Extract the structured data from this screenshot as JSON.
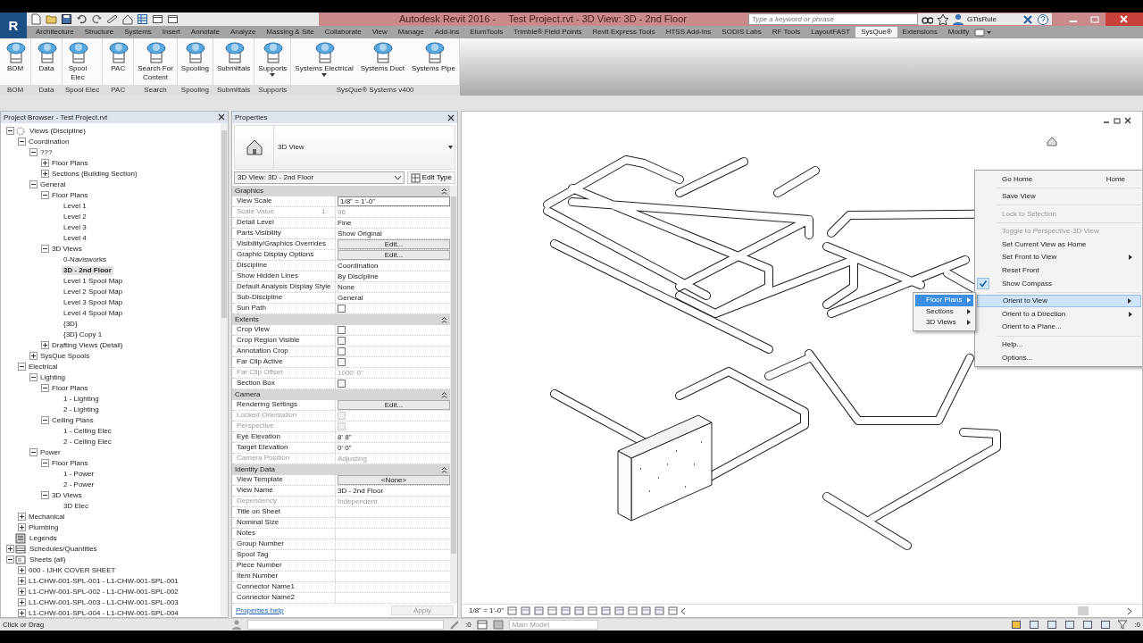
{
  "title_bar": {
    "app_button": "R",
    "app_name": "Autodesk Revit 2016 -",
    "document_title": "Test Project.rvt - 3D View: 3D - 2nd Floor",
    "search": {
      "placeholder": "Type a keyword or phrase"
    },
    "user": "GTisRule"
  },
  "ribbon_tabs": [
    {
      "label": "Architecture",
      "selected": false
    },
    {
      "label": "Structure",
      "selected": false
    },
    {
      "label": "Systems",
      "selected": false
    },
    {
      "label": "Insert",
      "selected": false
    },
    {
      "label": "Annotate",
      "selected": false
    },
    {
      "label": "Analyze",
      "selected": false
    },
    {
      "label": "Massing & Site",
      "selected": false
    },
    {
      "label": "Collaborate",
      "selected": false
    },
    {
      "label": "View",
      "selected": false
    },
    {
      "label": "Manage",
      "selected": false
    },
    {
      "label": "Add-Ins",
      "selected": false
    },
    {
      "label": "ElumTools",
      "selected": false
    },
    {
      "label": "Trimble® Field Points",
      "selected": false
    },
    {
      "label": "Revit Express Tools",
      "selected": false
    },
    {
      "label": "HTSS Add-Ins",
      "selected": false
    },
    {
      "label": "SODIS Labs",
      "selected": false
    },
    {
      "label": "RF Tools",
      "selected": false
    },
    {
      "label": "LayoutFAST",
      "selected": false
    },
    {
      "label": "SysQue®",
      "selected": true
    },
    {
      "label": "Extensions",
      "selected": false
    },
    {
      "label": "Modify",
      "selected": false
    }
  ],
  "ribbon_panels": [
    {
      "label": "BOM",
      "buttons": [
        {
          "label": "BOM",
          "dropdown": false
        }
      ]
    },
    {
      "label": "Data",
      "buttons": [
        {
          "label": "Data",
          "dropdown": false
        }
      ]
    },
    {
      "label": "Spool Elec",
      "buttons": [
        {
          "label": "Spool\nElec",
          "dropdown": false
        }
      ]
    },
    {
      "label": "PAC",
      "buttons": [
        {
          "label": "PAC",
          "dropdown": false
        }
      ]
    },
    {
      "label": "Search",
      "buttons": [
        {
          "label": "Search For\nContent",
          "dropdown": false
        }
      ]
    },
    {
      "label": "Spooling",
      "buttons": [
        {
          "label": "Spooling",
          "dropdown": false
        }
      ]
    },
    {
      "label": "Submittals",
      "buttons": [
        {
          "label": "Submittals",
          "dropdown": false
        }
      ]
    },
    {
      "label": "Supports",
      "buttons": [
        {
          "label": "Supports",
          "dropdown": true
        }
      ]
    },
    {
      "label": "SysQue® Systems v400",
      "buttons": [
        {
          "label": "Systems Electrical",
          "dropdown": true
        },
        {
          "label": "Systems Duct",
          "dropdown": false
        },
        {
          "label": "Systems Pipe",
          "dropdown": false
        }
      ]
    }
  ],
  "project_browser": {
    "title": "Project Browser - Test Project.rvt",
    "tree": [
      {
        "label": "Views (Discipline)",
        "kind": "views",
        "expanded": true,
        "selected": false,
        "children": [
          {
            "label": "Coordination",
            "expanded": true,
            "selected": false,
            "children": [
              {
                "label": "???",
                "expanded": true,
                "selected": false,
                "children": [
                  {
                    "label": "Floor Plans",
                    "expanded": false,
                    "selected": false
                  },
                  {
                    "label": "Sections (Building Section)",
                    "expanded": false,
                    "selected": false
                  }
                ]
              },
              {
                "label": "General",
                "expanded": true,
                "selected": false,
                "children": [
                  {
                    "label": "Floor Plans",
                    "expanded": true,
                    "selected": false,
                    "children": [
                      {
                        "label": "Level 1",
                        "selected": false
                      },
                      {
                        "label": "Level 2",
                        "selected": false
                      },
                      {
                        "label": "Level 3",
                        "selected": false
                      },
                      {
                        "label": "Level 4",
                        "selected": false
                      }
                    ]
                  },
                  {
                    "label": "3D Views",
                    "expanded": true,
                    "selected": false,
                    "children": [
                      {
                        "label": "0-Navisworks",
                        "selected": false
                      },
                      {
                        "label": "3D - 2nd Floor",
                        "selected": true
                      },
                      {
                        "label": "Level 1 Spool Map",
                        "selected": false
                      },
                      {
                        "label": "Level 2 Spool Map",
                        "selected": false
                      },
                      {
                        "label": "Level 3 Spool Map",
                        "selected": false
                      },
                      {
                        "label": "Level 4 Spool Map",
                        "selected": false
                      },
                      {
                        "label": "{3D}",
                        "selected": false
                      },
                      {
                        "label": "{3D} Copy 1",
                        "selected": false
                      }
                    ]
                  },
                  {
                    "label": "Drafting Views (Detail)",
                    "expanded": false,
                    "selected": false
                  }
                ]
              },
              {
                "label": "SysQue Spools",
                "expanded": false,
                "selected": false
              }
            ]
          },
          {
            "label": "Electrical",
            "expanded": true,
            "selected": false,
            "children": [
              {
                "label": "Lighting",
                "expanded": true,
                "selected": false,
                "children": [
                  {
                    "label": "Floor Plans",
                    "expanded": true,
                    "selected": false,
                    "children": [
                      {
                        "label": "1 - Lighting",
                        "selected": false
                      },
                      {
                        "label": "2 - Lighting",
                        "selected": false
                      }
                    ]
                  },
                  {
                    "label": "Ceiling Plans",
                    "expanded": true,
                    "selected": false,
                    "children": [
                      {
                        "label": "1 - Ceiling Elec",
                        "selected": false
                      },
                      {
                        "label": "2 - Ceiling Elec",
                        "selected": false
                      }
                    ]
                  }
                ]
              },
              {
                "label": "Power",
                "expanded": true,
                "selected": false,
                "children": [
                  {
                    "label": "Floor Plans",
                    "expanded": true,
                    "selected": false,
                    "children": [
                      {
                        "label": "1 - Power",
                        "selected": false
                      },
                      {
                        "label": "2 - Power",
                        "selected": false
                      }
                    ]
                  },
                  {
                    "label": "3D Views",
                    "expanded": true,
                    "selected": false,
                    "children": [
                      {
                        "label": "3D Elec",
                        "selected": false
                      }
                    ]
                  }
                ]
              }
            ]
          },
          {
            "label": "Mechanical",
            "expanded": false,
            "selected": false
          },
          {
            "label": "Plumbing",
            "expanded": false,
            "selected": false
          }
        ]
      },
      {
        "label": "Legends",
        "kind": "legends",
        "selected": false
      },
      {
        "label": "Schedules/Quantities",
        "kind": "schedules",
        "expanded": false,
        "selected": false
      },
      {
        "label": "Sheets (all)",
        "kind": "sheets",
        "expanded": true,
        "selected": false,
        "children": [
          {
            "label": "000 - IJHK COVER SHEET",
            "expanded": false,
            "selected": false
          },
          {
            "label": "L1-CHW-001-SPL-001 - L1-CHW-001-SPL-001",
            "expanded": false,
            "selected": false
          },
          {
            "label": "L1-CHW-001-SPL-002 - L1-CHW-001-SPL-002",
            "expanded": false,
            "selected": false
          },
          {
            "label": "L1-CHW-001-SPL-003 - L1-CHW-001-SPL-003",
            "expanded": false,
            "selected": false
          },
          {
            "label": "L1-CHW-001-SPL-004 - L1-CHW-001-SPL-004",
            "expanded": false,
            "selected": false
          }
        ]
      }
    ]
  },
  "properties": {
    "title": "Properties",
    "type_name": "3D View",
    "instance": "3D View: 3D - 2nd Floor",
    "edit_type": "Edit Type",
    "groups": [
      {
        "label": "Graphics",
        "rows": [
          {
            "label": "View Scale",
            "value": "1/8\" = 1'-0\"",
            "kind": "field",
            "disabled": false
          },
          {
            "label": "Scale Value",
            "suffix": "1:",
            "value": "96",
            "kind": "text",
            "disabled": true
          },
          {
            "label": "Detail Level",
            "value": "Fine",
            "kind": "text",
            "disabled": false
          },
          {
            "label": "Parts Visibility",
            "value": "Show Original",
            "kind": "text",
            "disabled": false
          },
          {
            "label": "Visibility/Graphics Overrides",
            "value": "Edit...",
            "kind": "button",
            "disabled": false
          },
          {
            "label": "Graphic Display Options",
            "value": "Edit...",
            "kind": "button",
            "disabled": false
          },
          {
            "label": "Discipline",
            "value": "Coordination",
            "kind": "text",
            "disabled": false
          },
          {
            "label": "Show Hidden Lines",
            "value": "By Discipline",
            "kind": "text",
            "disabled": false
          },
          {
            "label": "Default Analysis Display Style",
            "value": "None",
            "kind": "text",
            "disabled": false
          },
          {
            "label": "Sub-Discipline",
            "value": "General",
            "kind": "text",
            "disabled": false
          },
          {
            "label": "Sun Path",
            "kind": "checkbox",
            "checked": false,
            "disabled": false
          }
        ]
      },
      {
        "label": "Extents",
        "rows": [
          {
            "label": "Crop View",
            "kind": "checkbox",
            "checked": false,
            "disabled": false
          },
          {
            "label": "Crop Region Visible",
            "kind": "checkbox",
            "checked": false,
            "disabled": false
          },
          {
            "label": "Annotation Crop",
            "kind": "checkbox",
            "checked": false,
            "disabled": false
          },
          {
            "label": "Far Clip Active",
            "kind": "checkbox",
            "checked": false,
            "disabled": false
          },
          {
            "label": "Far Clip Offset",
            "value": "1000'  0\"",
            "kind": "text",
            "disabled": true
          },
          {
            "label": "Section Box",
            "kind": "checkbox",
            "checked": false,
            "disabled": false
          }
        ]
      },
      {
        "label": "Camera",
        "rows": [
          {
            "label": "Rendering Settings",
            "value": "Edit...",
            "kind": "button",
            "disabled": false
          },
          {
            "label": "Locked Orientation",
            "kind": "checkbox",
            "checked": false,
            "disabled": true
          },
          {
            "label": "Perspective",
            "kind": "checkbox",
            "checked": false,
            "disabled": true
          },
          {
            "label": "Eye Elevation",
            "value": "8'  8\"",
            "kind": "text",
            "disabled": false
          },
          {
            "label": "Target Elevation",
            "value": "0'  0\"",
            "kind": "text",
            "disabled": false
          },
          {
            "label": "Camera Position",
            "value": "Adjusting",
            "kind": "text",
            "disabled": true
          }
        ]
      },
      {
        "label": "Identity Data",
        "rows": [
          {
            "label": "View Template",
            "value": "<None>",
            "kind": "button",
            "disabled": false
          },
          {
            "label": "View Name",
            "value": "3D - 2nd Floor",
            "kind": "text",
            "disabled": false
          },
          {
            "label": "Dependency",
            "value": "Independent",
            "kind": "text",
            "disabled": true
          },
          {
            "label": "Title on Sheet",
            "kind": "text",
            "disabled": false
          },
          {
            "label": "Nominal Size",
            "kind": "text",
            "disabled": false
          },
          {
            "label": "Notes",
            "kind": "text",
            "disabled": false
          },
          {
            "label": "Group Number",
            "kind": "text",
            "disabled": false
          },
          {
            "label": "Spool Tag",
            "kind": "text",
            "disabled": false
          },
          {
            "label": "Piece Number",
            "kind": "text",
            "disabled": false
          },
          {
            "label": "Item Number",
            "kind": "text",
            "disabled": false
          },
          {
            "label": "Connector Name1",
            "kind": "text",
            "disabled": false
          },
          {
            "label": "Connector Name2",
            "kind": "text",
            "disabled": false
          }
        ]
      }
    ],
    "help_link": "Properties help",
    "apply": "Apply"
  },
  "view": {
    "scale": "1/8\" = 1'-0\"",
    "context_menu": [
      {
        "kind": "item",
        "label": "Go Home",
        "shortcut": "Home",
        "disabled": false,
        "checked": false,
        "selected": false,
        "submenu": false
      },
      {
        "kind": "separator"
      },
      {
        "kind": "item",
        "label": "Save View",
        "disabled": false,
        "checked": false,
        "selected": false,
        "submenu": false
      },
      {
        "kind": "separator"
      },
      {
        "kind": "item",
        "label": "Lock to Selection",
        "disabled": true,
        "checked": false,
        "selected": false,
        "submenu": false
      },
      {
        "kind": "separator"
      },
      {
        "kind": "item",
        "label": "Toggle to Perspective-3D View",
        "disabled": true,
        "checked": false,
        "selected": false,
        "submenu": false
      },
      {
        "kind": "item",
        "label": "Set Current View as Home",
        "disabled": false,
        "checked": false,
        "selected": false,
        "submenu": false
      },
      {
        "kind": "item",
        "label": "Set Front to View",
        "disabled": false,
        "checked": false,
        "selected": false,
        "submenu": true
      },
      {
        "kind": "item",
        "label": "Reset Front",
        "disabled": false,
        "checked": false,
        "selected": false,
        "submenu": false
      },
      {
        "kind": "item",
        "label": "Show Compass",
        "disabled": false,
        "checked": true,
        "selected": false,
        "submenu": false
      },
      {
        "kind": "separator"
      },
      {
        "kind": "item",
        "label": "Orient to View",
        "disabled": false,
        "checked": false,
        "selected": true,
        "submenu": true
      },
      {
        "kind": "item",
        "label": "Orient to a Direction",
        "disabled": false,
        "checked": false,
        "selected": false,
        "submenu": true
      },
      {
        "kind": "item",
        "label": "Orient to a Plane...",
        "disabled": false,
        "checked": false,
        "selected": false,
        "submenu": false
      },
      {
        "kind": "separator"
      },
      {
        "kind": "item",
        "label": "Help...",
        "disabled": false,
        "checked": false,
        "selected": false,
        "submenu": false
      },
      {
        "kind": "item",
        "label": "Options...",
        "disabled": false,
        "checked": false,
        "selected": false,
        "submenu": false
      }
    ],
    "submenu": [
      {
        "label": "Floor Plans",
        "selected": true
      },
      {
        "label": "Sections",
        "selected": false
      },
      {
        "label": "3D Views",
        "selected": false
      }
    ]
  },
  "status_bar": {
    "message": "Click or Drag",
    "selection_count": ":0",
    "workset": "Main Model",
    "filter_count": ":0"
  }
}
